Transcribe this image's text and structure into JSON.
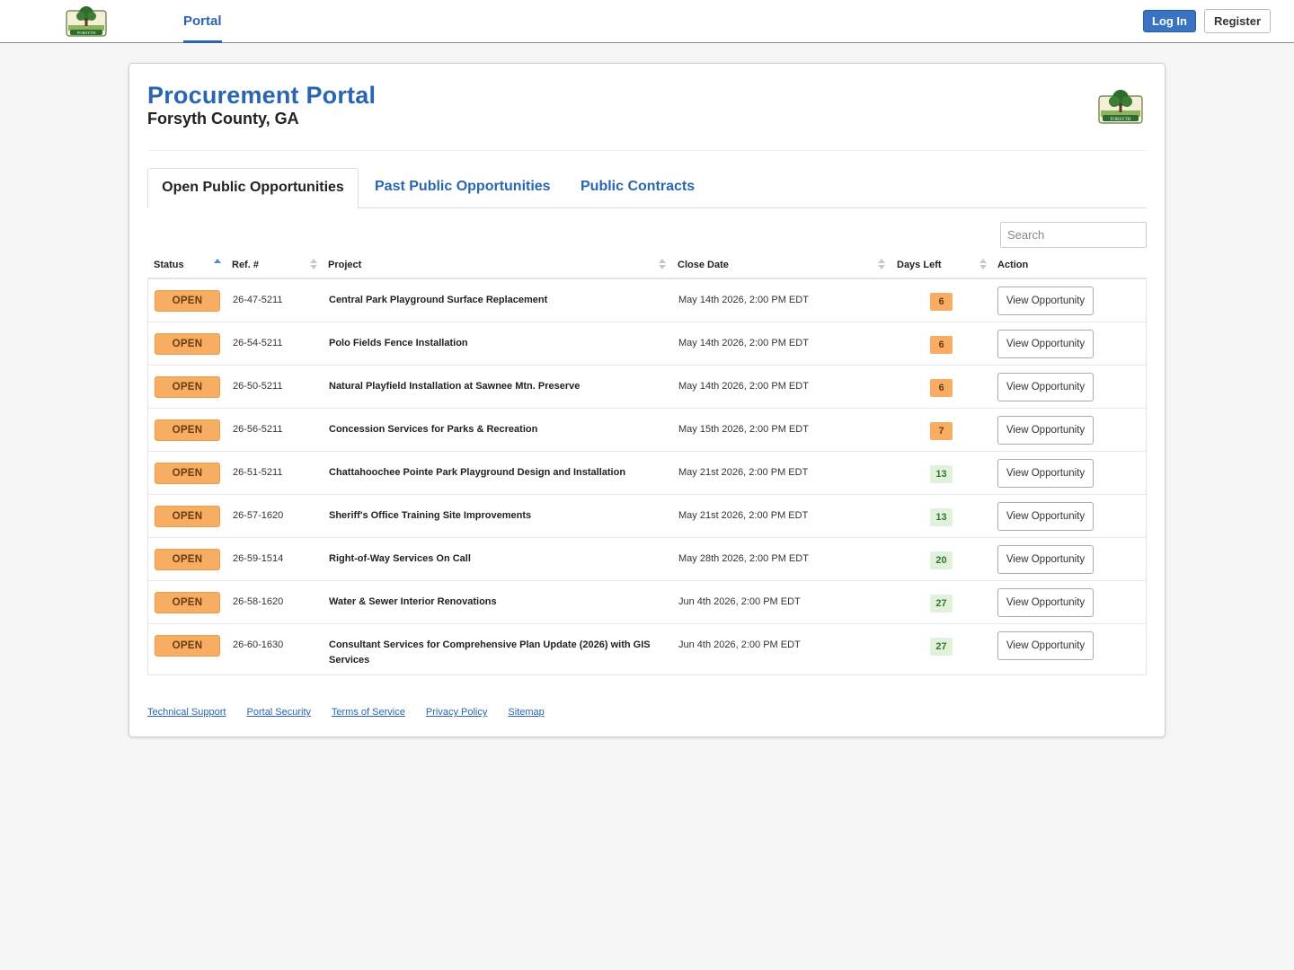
{
  "header": {
    "nav_label": "Portal",
    "login_label": "Log In",
    "register_label": "Register"
  },
  "page": {
    "title": "Procurement Portal",
    "subtitle": "Forsyth County, GA"
  },
  "tabs": [
    {
      "label": "Open Public Opportunities",
      "active": true
    },
    {
      "label": "Past Public Opportunities",
      "active": false
    },
    {
      "label": "Public Contracts",
      "active": false
    }
  ],
  "search": {
    "placeholder": "Search"
  },
  "table": {
    "columns": [
      "Status",
      "Ref. #",
      "Project",
      "Close Date",
      "Days Left",
      "Action"
    ],
    "rows": [
      {
        "status": "OPEN",
        "ref": "26-47-5211",
        "project": "Central Park Playground Surface Replacement",
        "close": "May 14th 2026, 2:00 PM EDT",
        "days": "6",
        "action": "View Opportunity"
      },
      {
        "status": "OPEN",
        "ref": "26-54-5211",
        "project": "Polo Fields Fence Installation",
        "close": "May 14th 2026, 2:00 PM EDT",
        "days": "6",
        "action": "View Opportunity"
      },
      {
        "status": "OPEN",
        "ref": "26-50-5211",
        "project": "Natural Playfield Installation at Sawnee Mtn. Preserve",
        "close": "May 14th 2026, 2:00 PM EDT",
        "days": "6",
        "action": "View Opportunity"
      },
      {
        "status": "OPEN",
        "ref": "26-56-5211",
        "project": "Concession Services for Parks & Recreation",
        "close": "May 15th 2026, 2:00 PM EDT",
        "days": "7",
        "action": "View Opportunity"
      },
      {
        "status": "OPEN",
        "ref": "26-51-5211",
        "project": "Chattahoochee Pointe Park Playground Design and Installation",
        "close": "May 21st 2026, 2:00 PM EDT",
        "days": "13",
        "action": "View Opportunity"
      },
      {
        "status": "OPEN",
        "ref": "26-57-1620",
        "project": "Sheriff's Office Training Site Improvements",
        "close": "May 21st 2026, 2:00 PM EDT",
        "days": "13",
        "action": "View Opportunity"
      },
      {
        "status": "OPEN",
        "ref": "26-59-1514",
        "project": "Right-of-Way Services On Call",
        "close": "May 28th 2026, 2:00 PM EDT",
        "days": "20",
        "action": "View Opportunity"
      },
      {
        "status": "OPEN",
        "ref": "26-58-1620",
        "project": "Water & Sewer Interior Renovations",
        "close": "Jun 4th 2026, 2:00 PM EDT",
        "days": "27",
        "action": "View Opportunity"
      },
      {
        "status": "OPEN",
        "ref": "26-60-1630",
        "project": "Consultant Services for Comprehensive Plan Update (2026) with GIS Services",
        "close": "Jun 4th 2026, 2:00 PM EDT",
        "days": "27",
        "action": "View Opportunity"
      }
    ]
  },
  "footer": {
    "links": [
      "Technical Support",
      "Portal Security",
      "Terms of Service",
      "Privacy Policy",
      "Sitemap"
    ]
  },
  "colors": {
    "brand_blue": "#2a66b0",
    "open_badge": "#f7ad62",
    "days_ok": "#e1f1dc"
  }
}
